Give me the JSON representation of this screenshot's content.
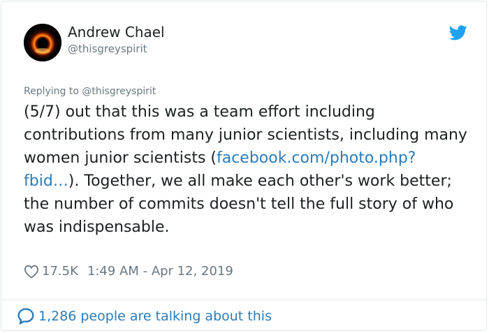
{
  "author": {
    "name": "Andrew Chael",
    "handle": "@thisgreyspirit",
    "avatar_icon": "black-hole-image"
  },
  "platform_icon": "twitter-bird-icon",
  "replying_to": "Replying to @thisgreyspirit",
  "tweet": {
    "text_before_link": "(5/7) out that this was a team effort including contributions from many junior scientists, including many women junior scientists (",
    "link_text": "facebook.com/photo.php?fbid…",
    "text_after_link": "). Together, we all make each other's work better; the number of commits doesn't tell the full story of who was indispensable."
  },
  "meta": {
    "likes": "17.5K",
    "timestamp": "1:49 AM - Apr 12, 2019"
  },
  "footer": {
    "talking_text": "1,286 people are talking about this"
  },
  "colors": {
    "link": "#2b7bb9",
    "secondary_text": "#697882",
    "twitter_blue": "#1da1f2"
  }
}
